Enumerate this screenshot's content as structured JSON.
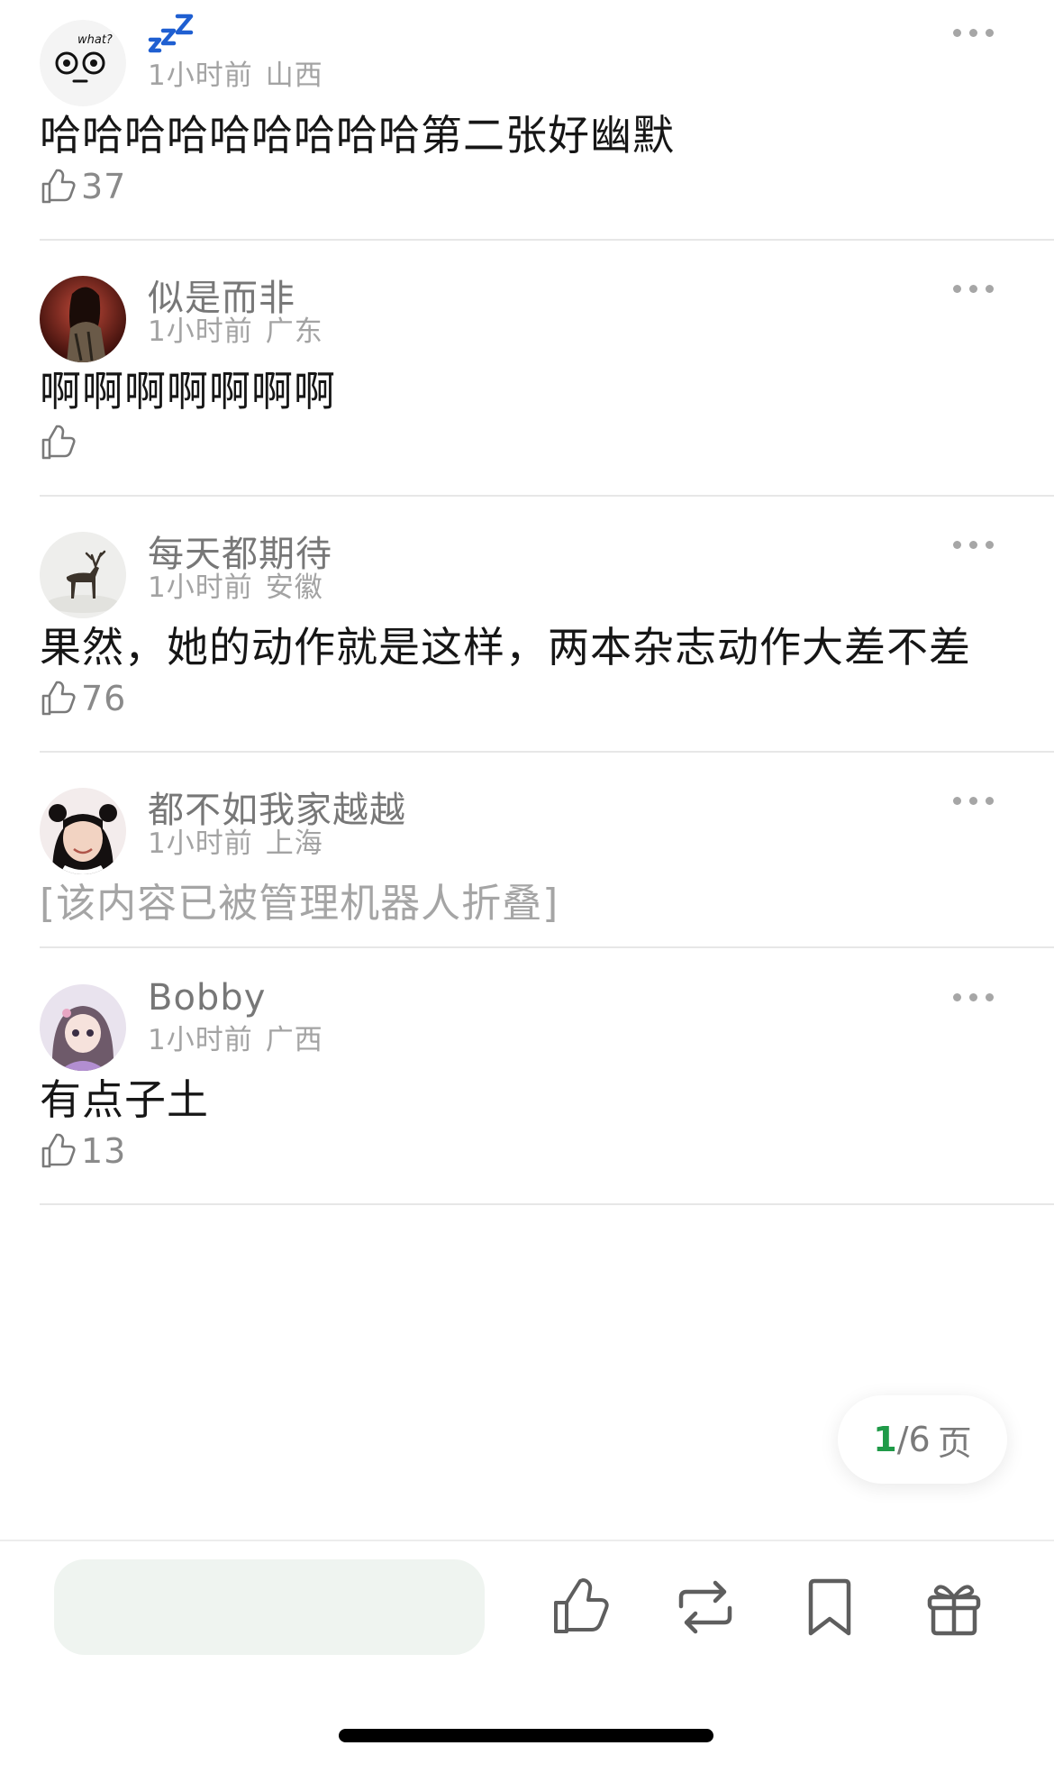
{
  "comments": [
    {
      "username": "zZZ",
      "time": "1小时前",
      "location": "山西",
      "text": "哈哈哈哈哈哈哈哈哈第二张好幽默",
      "likes": "37",
      "avatar_caption": "what?"
    },
    {
      "username": "似是而非",
      "time": "1小时前",
      "location": "广东",
      "text": "啊啊啊啊啊啊啊",
      "likes": ""
    },
    {
      "username": "每天都期待",
      "time": "1小时前",
      "location": "安徽",
      "text": "果然，她的动作就是这样，两本杂志动作大差不差",
      "likes": "76"
    },
    {
      "username": "都不如我家越越",
      "time": "1小时前",
      "location": "上海",
      "text": "[该内容已被管理机器人折叠]",
      "likes": ""
    },
    {
      "username": "Bobby",
      "time": "1小时前",
      "location": "广西",
      "text": "有点子土",
      "likes": "13"
    }
  ],
  "pager": {
    "current": "1",
    "total": "/6",
    "unit": "页"
  },
  "bottom_bar": {
    "icons": [
      "thumb-up-icon",
      "repost-icon",
      "bookmark-icon",
      "gift-icon"
    ]
  },
  "colors": {
    "accent": "#1f9a48",
    "input_bg": "#eff4f0",
    "meta_text": "#a3a3a3"
  }
}
